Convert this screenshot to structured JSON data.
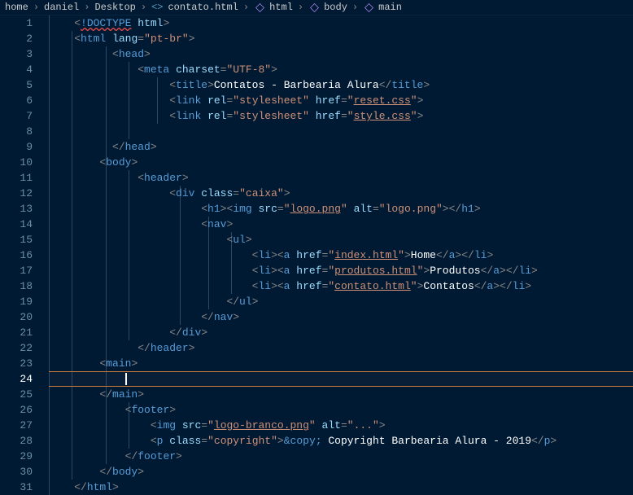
{
  "breadcrumb": {
    "p1": "home",
    "p2": "daniel",
    "p3": "Desktop",
    "file": "contato.html",
    "s1": "html",
    "s2": "body",
    "s3": "main"
  },
  "lines": {
    "n1": "1",
    "n2": "2",
    "n3": "3",
    "n4": "4",
    "n5": "5",
    "n6": "6",
    "n7": "7",
    "n8": "8",
    "n9": "9",
    "n10": "10",
    "n11": "11",
    "n12": "12",
    "n13": "13",
    "n14": "14",
    "n15": "15",
    "n16": "16",
    "n17": "17",
    "n18": "18",
    "n19": "19",
    "n20": "20",
    "n21": "21",
    "n22": "22",
    "n23": "23",
    "n24": "24",
    "n25": "25",
    "n26": "26",
    "n27": "27",
    "n28": "28",
    "n29": "29",
    "n30": "30",
    "n31": "31"
  },
  "code": {
    "l1": {
      "doctype": "!DOCTYPE",
      "html": "html"
    },
    "l2": {
      "tag": "html",
      "attr": "lang",
      "val": "\"pt-br\""
    },
    "l3": {
      "tag": "head"
    },
    "l4": {
      "tag": "meta",
      "attr": "charset",
      "val": "\"UTF-8\""
    },
    "l5": {
      "tag": "title",
      "text": "Contatos - Barbearia Alura"
    },
    "l6": {
      "tag": "link",
      "a1": "rel",
      "v1": "\"stylesheet\"",
      "a2": "href",
      "v2q": "\"",
      "v2": "reset.css"
    },
    "l7": {
      "tag": "link",
      "a1": "rel",
      "v1": "\"stylesheet\"",
      "a2": "href",
      "v2q": "\"",
      "v2": "style.css"
    },
    "l9": {
      "tag": "head"
    },
    "l10": {
      "tag": "body"
    },
    "l11": {
      "tag": "header"
    },
    "l12": {
      "tag": "div",
      "attr": "class",
      "val": "\"caixa\""
    },
    "l13": {
      "h1": "h1",
      "img": "img",
      "src": "src",
      "srcq": "\"",
      "srcv": "logo.png",
      "alt": "alt",
      "altv": "\"logo.png\""
    },
    "l14": {
      "tag": "nav"
    },
    "l15": {
      "tag": "ul"
    },
    "l16": {
      "li": "li",
      "a": "a",
      "href": "href",
      "q": "\"",
      "link": "index.html",
      "text": "Home"
    },
    "l17": {
      "li": "li",
      "a": "a",
      "href": "href",
      "q": "\"",
      "link": "produtos.html",
      "text": "Produtos"
    },
    "l18": {
      "li": "li",
      "a": "a",
      "href": "href",
      "q": "\"",
      "link": "contato.html",
      "text": "Contatos"
    },
    "l19": {
      "tag": "ul"
    },
    "l20": {
      "tag": "nav"
    },
    "l21": {
      "tag": "div"
    },
    "l22": {
      "tag": "header"
    },
    "l23": {
      "tag": "main"
    },
    "l25": {
      "tag": "main"
    },
    "l26": {
      "tag": "footer"
    },
    "l27": {
      "img": "img",
      "src": "src",
      "q": "\"",
      "srcv": "logo-branco.png",
      "alt": "alt",
      "altv": "\"...\""
    },
    "l28": {
      "p": "p",
      "cls": "class",
      "clsv": "\"copyright\"",
      "ent": "&copy;",
      "text": " Copyright Barbearia Alura - 2019"
    },
    "l29": {
      "tag": "footer"
    },
    "l30": {
      "tag": "body"
    },
    "l31": {
      "tag": "html"
    }
  }
}
